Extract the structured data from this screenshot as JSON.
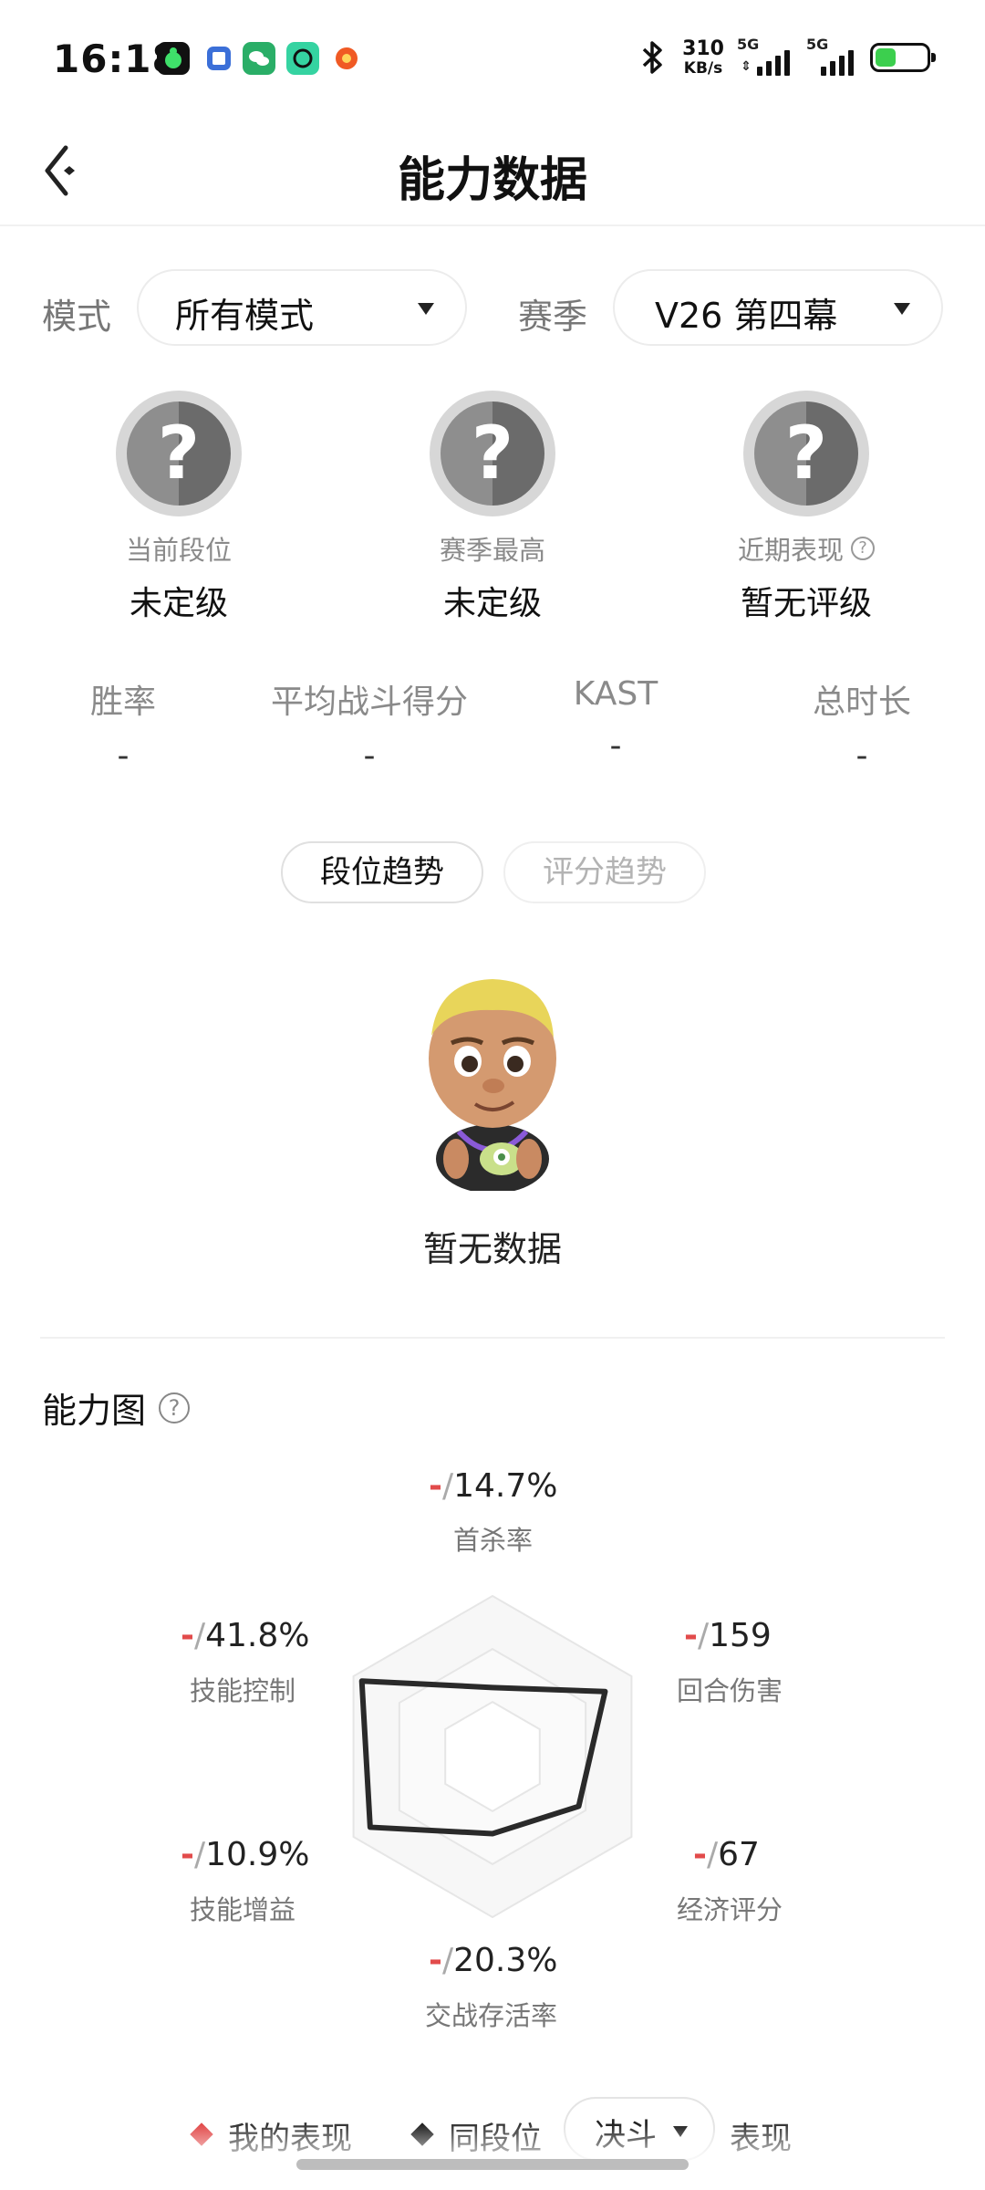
{
  "status_bar": {
    "time": "16:18",
    "net_speed_value": "310",
    "net_speed_unit": "KB/s",
    "signal1_label": "5G",
    "signal2_label": "5G",
    "notification_icons": [
      "game-icon",
      "tieba-icon",
      "wechat-icon",
      "camera-app-icon",
      "weibo-icon"
    ]
  },
  "header": {
    "title": "能力数据"
  },
  "filters": {
    "mode_label": "模式",
    "mode_value": "所有模式",
    "season_label": "赛季",
    "season_value": "V26 第四幕"
  },
  "ranks": [
    {
      "label": "当前段位",
      "value": "未定级"
    },
    {
      "label": "赛季最高",
      "value": "未定级"
    },
    {
      "label": "近期表现",
      "value": "暂无评级"
    }
  ],
  "stats": [
    {
      "label": "胜率",
      "value": "-"
    },
    {
      "label": "平均战斗得分",
      "value": "-"
    },
    {
      "label": "KAST",
      "value": "-"
    },
    {
      "label": "总时长",
      "value": "-"
    }
  ],
  "trend_tabs": [
    {
      "label": "段位趋势",
      "active": true
    },
    {
      "label": "评分趋势",
      "active": false
    }
  ],
  "empty_state": "暂无数据",
  "ability": {
    "title": "能力图",
    "axes": [
      {
        "name": "首杀率",
        "mine": "-",
        "ref": "14.7%"
      },
      {
        "name": "回合伤害",
        "mine": "-",
        "ref": "159"
      },
      {
        "name": "经济评分",
        "mine": "-",
        "ref": "67"
      },
      {
        "name": "交战存活率",
        "mine": "-",
        "ref": "20.3%"
      },
      {
        "name": "技能增益",
        "mine": "-",
        "ref": "10.9%"
      },
      {
        "name": "技能控制",
        "mine": "-",
        "ref": "41.8%"
      }
    ],
    "separator": "/",
    "ref_profile": [
      0.43,
      0.81,
      0.62,
      0.48,
      0.88,
      0.94
    ]
  },
  "legend": {
    "mine_label": "我的表现",
    "ref_label": "同段位",
    "ref_select": "决斗",
    "suffix": "表现"
  },
  "colors": {
    "accent_red": "#e24b4b",
    "ref_line": "#2a2a2a",
    "wechat_green": "#2aae67"
  }
}
